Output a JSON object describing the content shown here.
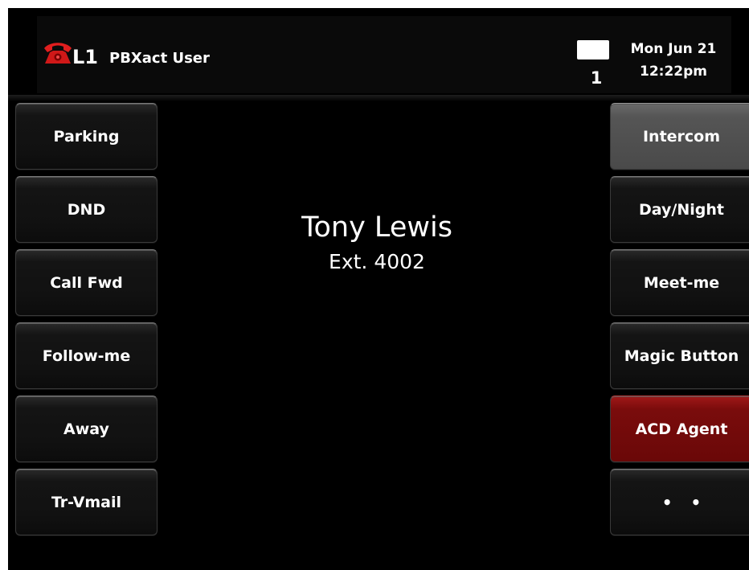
{
  "header": {
    "phone_icon": "red-phone-handset-icon",
    "line": "L1",
    "user": "PBXact User",
    "message_icon": "message-envelope-icon",
    "message_count": "1",
    "date": "Mon Jun 21",
    "time": "12:22pm"
  },
  "left_buttons": [
    {
      "label": "Parking"
    },
    {
      "label": "DND"
    },
    {
      "label": "Call Fwd"
    },
    {
      "label": "Follow-me"
    },
    {
      "label": "Away"
    },
    {
      "label": "Tr-Vmail"
    }
  ],
  "right_buttons": [
    {
      "label": "Intercom",
      "state": "selected"
    },
    {
      "label": "Day/Night"
    },
    {
      "label": "Meet-me"
    },
    {
      "label": "Magic Button"
    },
    {
      "label": "ACD Agent",
      "state": "active"
    },
    {
      "label": "• •"
    }
  ],
  "contact": {
    "name": "Tony Lewis",
    "extension": "Ext. 4002"
  },
  "colors": {
    "background": "#000000",
    "selected_button": "#555555",
    "active_button": "#7a0c0c",
    "text": "#ffffff"
  }
}
